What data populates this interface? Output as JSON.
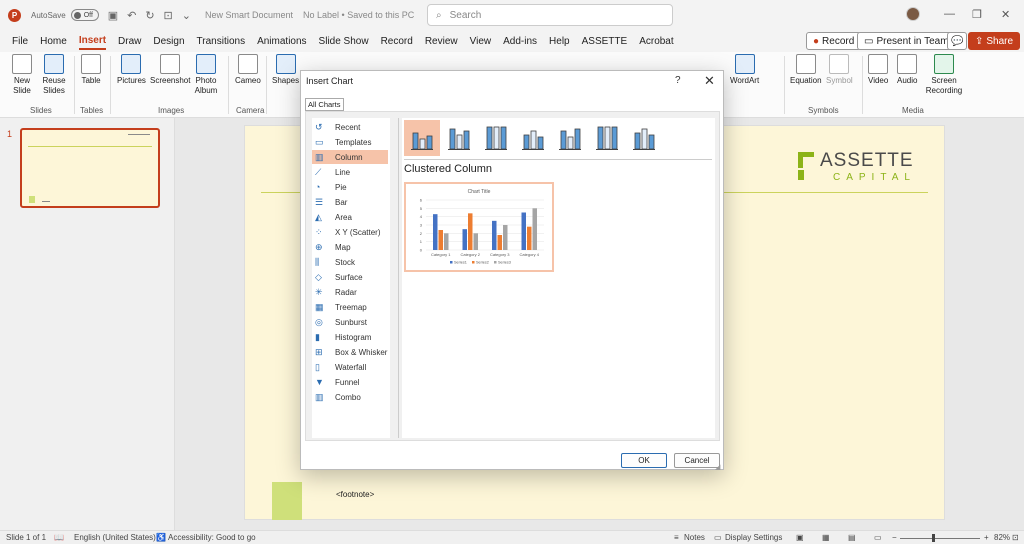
{
  "titlebar": {
    "autosave_label": "AutoSave",
    "autosave_state": "Off",
    "document_title": "New Smart Document",
    "label_status": "No Label • Saved to this PC",
    "search_placeholder": "Search"
  },
  "tabs": [
    "File",
    "Home",
    "Insert",
    "Draw",
    "Design",
    "Transitions",
    "Animations",
    "Slide Show",
    "Record",
    "Review",
    "View",
    "Add-ins",
    "Help",
    "ASSETTE",
    "Acrobat"
  ],
  "active_tab": "Insert",
  "tab_actions": {
    "record": "Record",
    "present": "Present in Teams",
    "share": "Share"
  },
  "ribbon": {
    "new_slide": "New Slide",
    "reuse_slides": "Reuse Slides",
    "table": "Table",
    "pictures": "Pictures",
    "screenshot": "Screenshot",
    "photo_album": "Photo Album",
    "cameo": "Cameo",
    "shapes": "Shapes",
    "wordart": "WordArt",
    "equation": "Equation",
    "symbol": "Symbol",
    "video": "Video",
    "audio": "Audio",
    "screen_recording": "Screen Recording",
    "groups": {
      "slides": "Slides",
      "tables": "Tables",
      "images": "Images",
      "camera": "Camera",
      "symbols": "Symbols",
      "media": "Media"
    }
  },
  "thumbnail": {
    "number": "1"
  },
  "slide": {
    "logo_name": "ASSETTE",
    "logo_sub": "CAPITAL",
    "footnote": "<footnote>"
  },
  "dialog": {
    "title": "Insert Chart",
    "help": "?",
    "tab": "All Charts",
    "categories": [
      "Recent",
      "Templates",
      "Column",
      "Line",
      "Pie",
      "Bar",
      "Area",
      "X Y (Scatter)",
      "Map",
      "Stock",
      "Surface",
      "Radar",
      "Treemap",
      "Sunburst",
      "Histogram",
      "Box & Whisker",
      "Waterfall",
      "Funnel",
      "Combo"
    ],
    "selected_category": "Column",
    "selected_type": "Clustered Column",
    "ok": "OK",
    "cancel": "Cancel"
  },
  "preview_chart": {
    "type": "bar",
    "title": "Chart Title",
    "categories": [
      "Category 1",
      "Category 2",
      "Category 3",
      "Category 4"
    ],
    "ylim": [
      0,
      6
    ],
    "series": [
      {
        "name": "Series1",
        "color": "#4472c4",
        "values": [
          4.3,
          2.5,
          3.5,
          4.5
        ]
      },
      {
        "name": "Series2",
        "color": "#ed7d31",
        "values": [
          2.4,
          4.4,
          1.8,
          2.8
        ]
      },
      {
        "name": "Series3",
        "color": "#a5a5a5",
        "values": [
          2,
          2,
          3,
          5
        ]
      }
    ]
  },
  "statusbar": {
    "slide_info": "Slide 1 of 1",
    "language": "English (United States)",
    "accessibility": "Accessibility: Good to go",
    "notes": "Notes",
    "display_settings": "Display Settings",
    "zoom": "82%"
  },
  "colors": {
    "accent": "#c43e1c",
    "selection": "#f6c3a9",
    "slide_bg": "#fdf6d8",
    "logo_green": "#8cb318"
  }
}
